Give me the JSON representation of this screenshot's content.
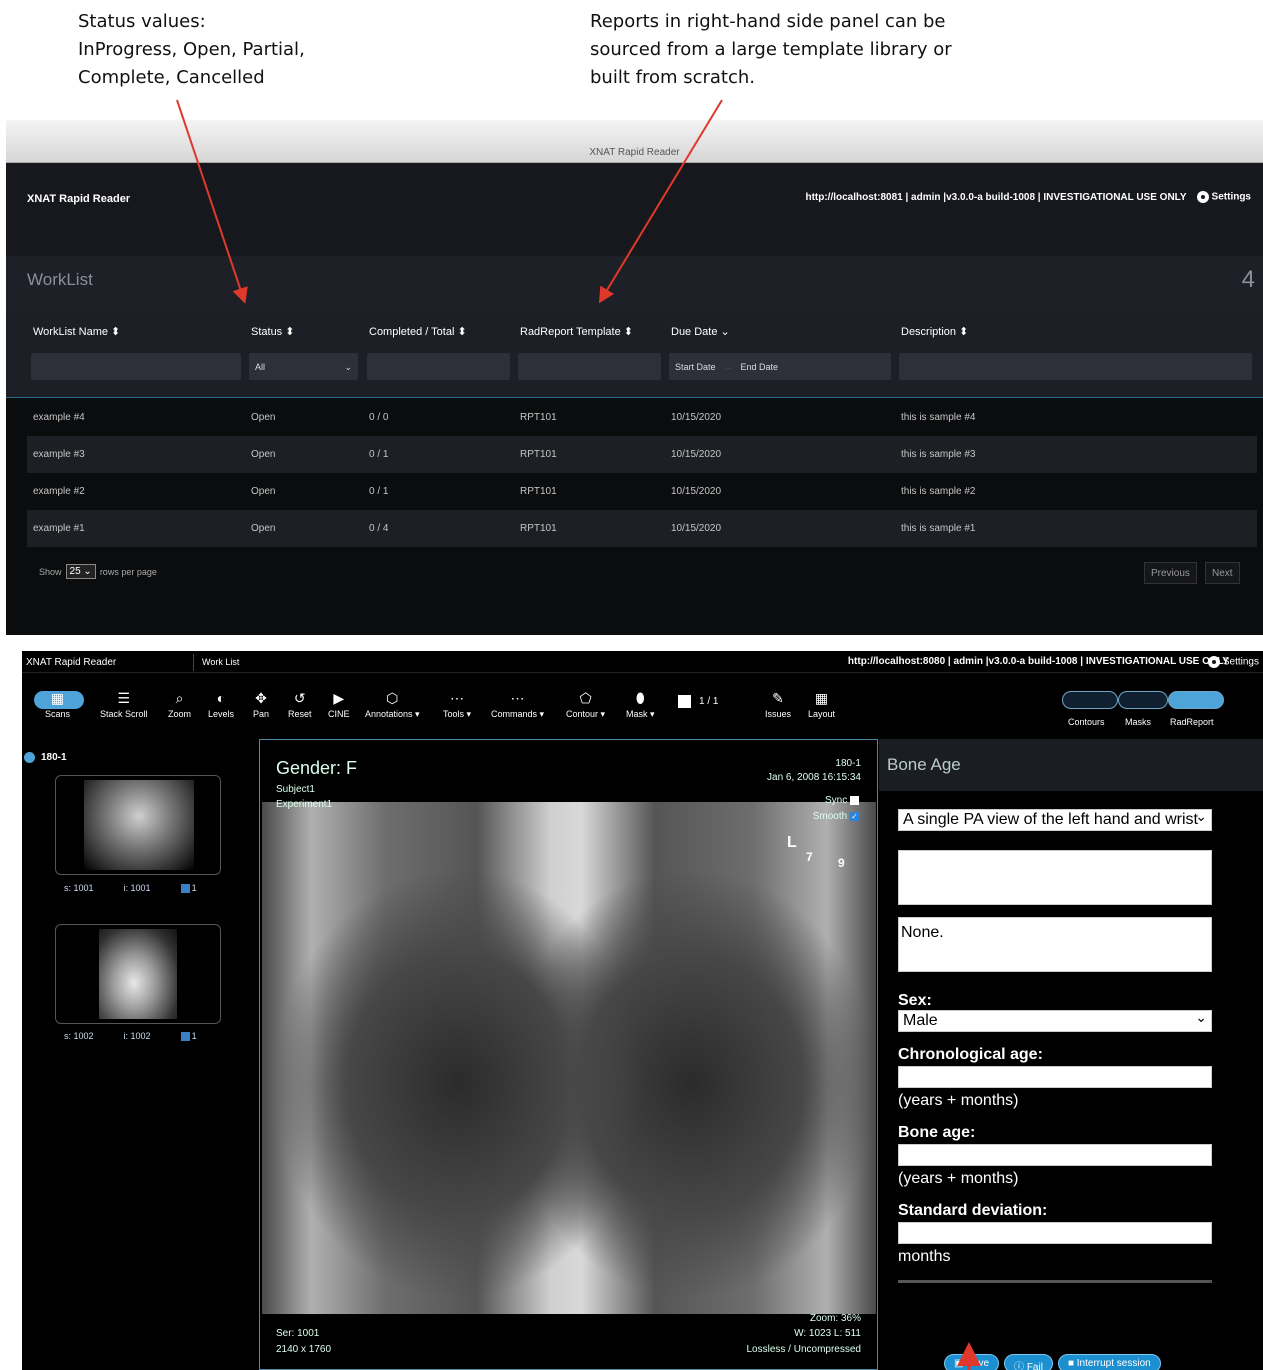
{
  "annotations": {
    "left": [
      "Status values:",
      "InProgress, Open, Partial,",
      "Complete, Cancelled"
    ],
    "right": [
      "Reports in right-hand side panel can be",
      "sourced from a large template library or",
      "built from scratch."
    ]
  },
  "worklist": {
    "window_title": "XNAT Rapid Reader",
    "app_name": "XNAT Rapid Reader",
    "server_info": "http://localhost:8081 | admin |v3.0.0-a build-1008 | INVESTIGATIONAL USE ONLY",
    "settings_label": "Settings",
    "title": "WorkList",
    "count": "4",
    "columns": [
      "WorkList Name ⬍",
      "Status ⬍",
      "Completed / Total ⬍",
      "RadReport Template ⬍",
      "Due Date ⌄",
      "Description ⬍"
    ],
    "filters": {
      "status": "All",
      "start_date": "Start Date",
      "end_date": "End Date"
    },
    "rows": [
      {
        "name": "example #4",
        "status": "Open",
        "completed": "0 / 0",
        "template": "RPT101",
        "due": "10/15/2020",
        "desc": "this is sample #4"
      },
      {
        "name": "example #3",
        "status": "Open",
        "completed": "0 / 1",
        "template": "RPT101",
        "due": "10/15/2020",
        "desc": "this is sample #3"
      },
      {
        "name": "example #2",
        "status": "Open",
        "completed": "0 / 1",
        "template": "RPT101",
        "due": "10/15/2020",
        "desc": "this is sample #2"
      },
      {
        "name": "example #1",
        "status": "Open",
        "completed": "0 / 4",
        "template": "RPT101",
        "due": "10/15/2020",
        "desc": "this is sample #1"
      }
    ],
    "pager": {
      "show": "Show",
      "size": "25",
      "suffix": "rows per page",
      "previous": "Previous",
      "next": "Next"
    }
  },
  "viewer": {
    "app_name": "XNAT Rapid Reader",
    "tab": "Work List",
    "server_info": "http://localhost:8080 | admin |v3.0.0-a build-1008 | INVESTIGATIONAL USE ONLY",
    "settings_label": "Settings",
    "tools": [
      "Scans",
      "Stack Scroll",
      "Zoom",
      "Levels",
      "Pan",
      "Reset",
      "CINE",
      "Annotations ▾",
      "Tools ▾",
      "Commands ▾",
      "Contour ▾",
      "Mask ▾",
      "1 / 1",
      "Issues",
      "Layout"
    ],
    "right_tools": [
      "Contours",
      "Masks",
      "RadReport"
    ],
    "session": "180-1",
    "thumbs": [
      {
        "s": "s: 1001",
        "i": "i: 1001",
        "n": "1"
      },
      {
        "s": "s: 1002",
        "i": "i: 1002",
        "n": "1"
      }
    ],
    "overlay": {
      "gender": "Gender: F",
      "subject": "Subject1",
      "experiment": "Experiment1",
      "id": "180-1",
      "date": "Jan 6, 2008 16:15:34",
      "sync": "Sync",
      "smooth": "Smooth",
      "marker_l": "L",
      "marker_7": "7",
      "marker_9": "9",
      "zoom": "Zoom: 36%",
      "wl": "W: 1023 L: 511",
      "compression": "Lossless / Uncompressed",
      "series": "Ser: 1001",
      "dims": "2140 x 1760"
    },
    "report": {
      "title": "Bone Age",
      "view_select": "A single PA view of the left hand and wrist",
      "findings": "",
      "impression": "None.",
      "sex_label": "Sex:",
      "sex_value": "Male",
      "chrono_label": "Chronological age:",
      "chrono_note": "(years + months)",
      "bone_label": "Bone age:",
      "bone_note": "(years + months)",
      "sd_label": "Standard deviation:",
      "sd_note": "months",
      "save": "Save",
      "fail": "Fail",
      "interrupt": "Interrupt session"
    }
  }
}
